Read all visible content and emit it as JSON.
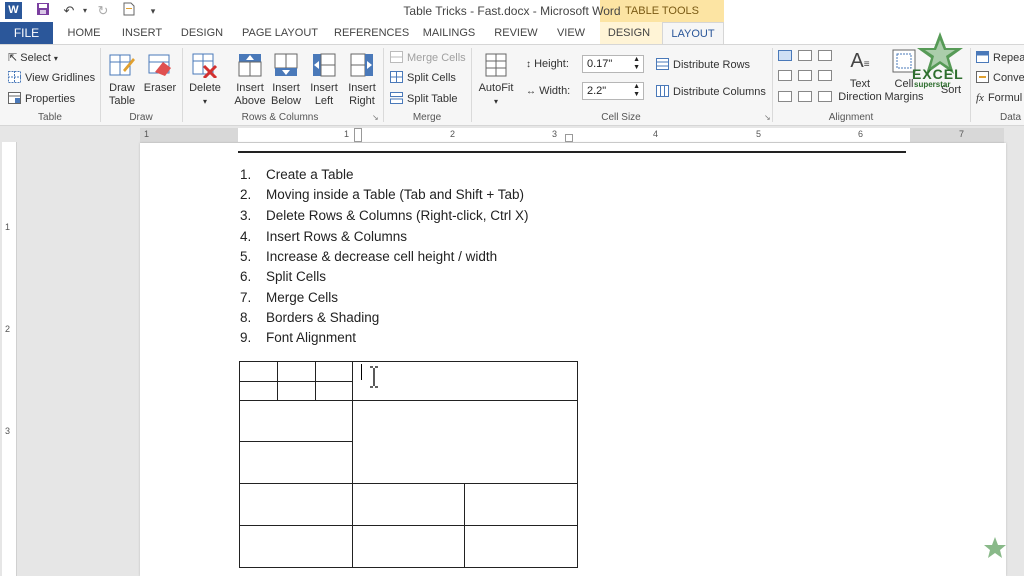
{
  "title_bar": {
    "document_title": "Table Tricks - Fast.docx - Microsoft Word",
    "context_group": "TABLE TOOLS",
    "quick_access": [
      "save-icon",
      "undo-icon",
      "redo-icon",
      "new-document-icon"
    ]
  },
  "tabs": {
    "file": "FILE",
    "items": [
      "HOME",
      "INSERT",
      "DESIGN",
      "PAGE LAYOUT",
      "REFERENCES",
      "MAILINGS",
      "REVIEW",
      "VIEW"
    ],
    "context_tabs": [
      "DESIGN",
      "LAYOUT"
    ],
    "active": "LAYOUT"
  },
  "ribbon": {
    "table_group": {
      "select": "Select",
      "view_gridlines": "View Gridlines",
      "properties": "Properties",
      "label": "Table"
    },
    "draw_group": {
      "draw_table_1": "Draw",
      "draw_table_2": "Table",
      "eraser": "Eraser",
      "label": "Draw"
    },
    "rows_columns_group": {
      "delete": "Delete",
      "insert_above_1": "Insert",
      "insert_above_2": "Above",
      "insert_below_1": "Insert",
      "insert_below_2": "Below",
      "insert_left_1": "Insert",
      "insert_left_2": "Left",
      "insert_right_1": "Insert",
      "insert_right_2": "Right",
      "label": "Rows & Columns"
    },
    "merge_group": {
      "merge_cells": "Merge Cells",
      "split_cells": "Split Cells",
      "split_table": "Split Table",
      "label": "Merge"
    },
    "cell_size_group": {
      "autofit": "AutoFit",
      "height_label": "Height:",
      "height_value": "0.17\"",
      "width_label": "Width:",
      "width_value": "2.2\"",
      "distribute_rows": "Distribute Rows",
      "distribute_columns": "Distribute Columns",
      "label": "Cell Size"
    },
    "alignment_group": {
      "text_direction_1": "Text",
      "text_direction_2": "Direction",
      "cell_margins_1": "Cell",
      "cell_margins_2": "Margins",
      "sort": "Sort",
      "label": "Alignment"
    },
    "data_group": {
      "repeat": "Repeat",
      "convert": "Conver",
      "formula": "Formul",
      "label": "Data"
    }
  },
  "ruler": {
    "horizontal_numbers": [
      "1",
      "1",
      "2",
      "3",
      "4",
      "5",
      "6",
      "7"
    ],
    "vertical_numbers": [
      "1",
      "2",
      "3"
    ]
  },
  "document": {
    "list": [
      {
        "n": "1.",
        "text": "Create a Table"
      },
      {
        "n": "2.",
        "text": "Moving inside a Table (Tab and Shift + Tab)"
      },
      {
        "n": "3.",
        "text": "Delete Rows & Columns (Right-click, Ctrl X)"
      },
      {
        "n": "4.",
        "text": "Insert Rows & Columns"
      },
      {
        "n": "5.",
        "text": "Increase & decrease cell height / width"
      },
      {
        "n": "6.",
        "text": "Split Cells"
      },
      {
        "n": "7.",
        "text": "Merge Cells"
      },
      {
        "n": "8.",
        "text": "Borders & Shading"
      },
      {
        "n": "9.",
        "text": "Font Alignment"
      }
    ]
  },
  "watermark": {
    "logo_text_1": "EXCEL",
    "logo_text_2": "superstar"
  },
  "colors": {
    "word_blue": "#2b579a",
    "table_tools": "#fce4a3",
    "ribbon_bg": "#f6f6f6",
    "logo_green": "#3a8a3a"
  }
}
